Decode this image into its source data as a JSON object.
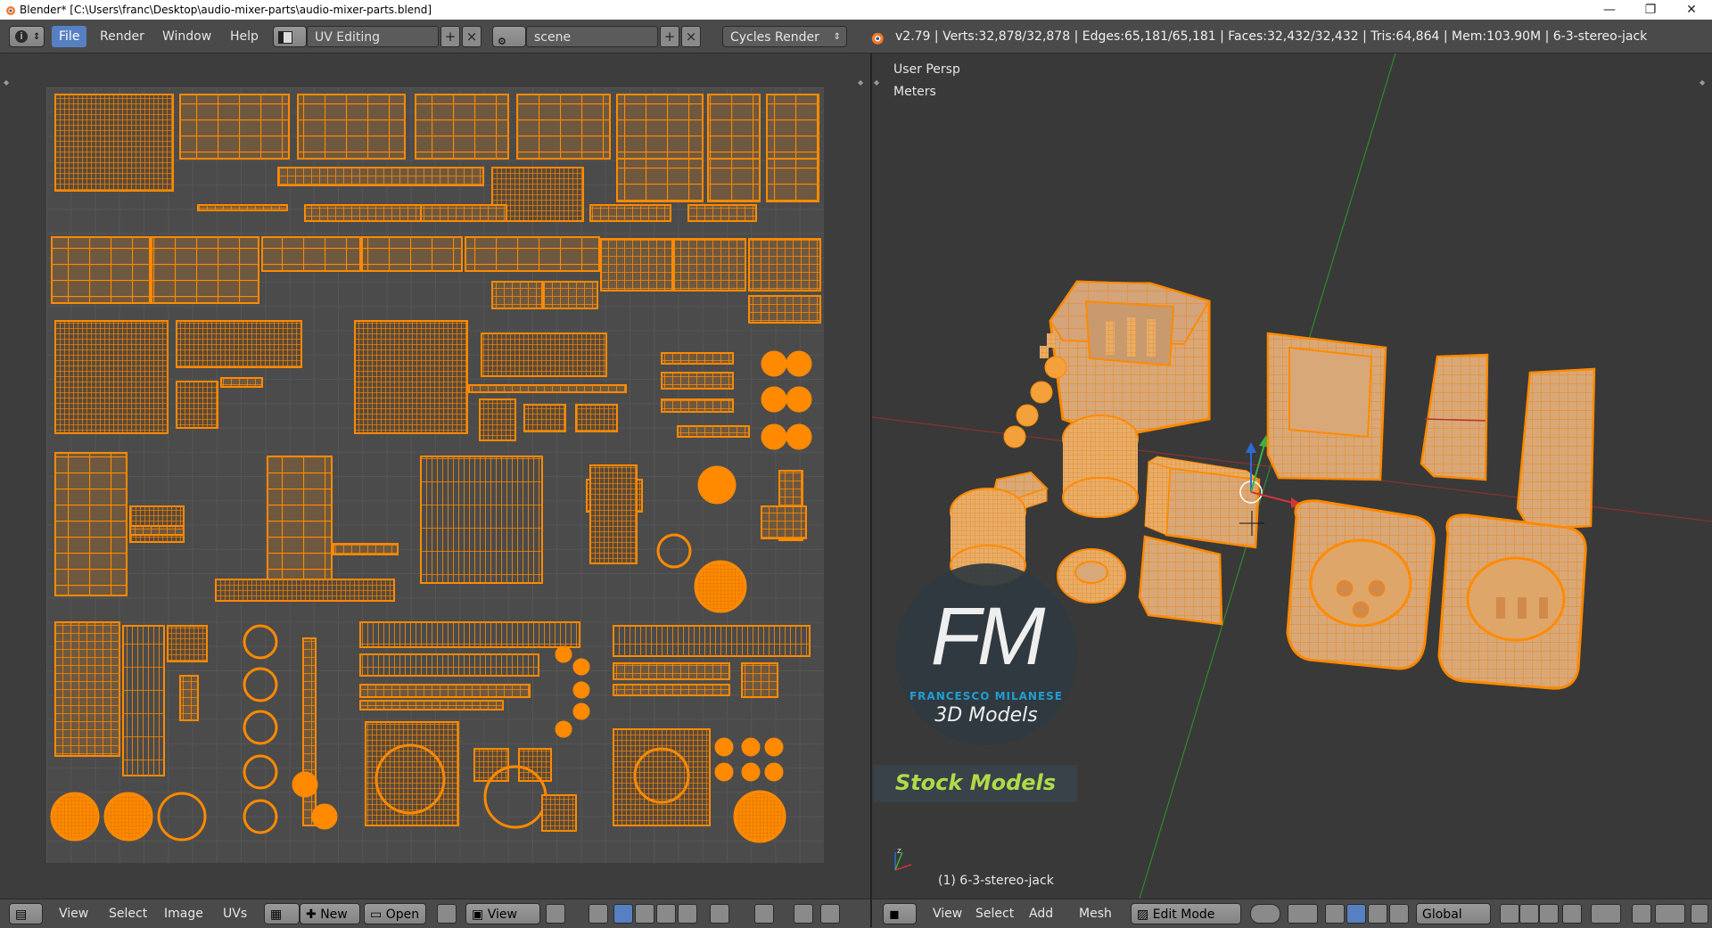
{
  "window": {
    "title": "Blender* [C:\\Users\\franc\\Desktop\\audio-mixer-parts\\audio-mixer-parts.blend]",
    "minimize": "—",
    "restore": "❐",
    "close": "✕"
  },
  "info_header": {
    "menus": [
      "File",
      "Render",
      "Window",
      "Help"
    ],
    "active_menu": "File",
    "layout": "UV Editing",
    "scene": "scene",
    "engine": "Cycles Render",
    "stats": "v2.79 | Verts:32,878/32,878 | Edges:65,181/65,181 | Faces:32,432/32,432 | Tris:64,864 | Mem:103.90M | 6-3-stereo-jack"
  },
  "viewport": {
    "view_name": "User Persp",
    "units": "Meters",
    "object_label": "(1) 6-3-stereo-jack"
  },
  "watermark": {
    "logo": "FM",
    "company": "FRANCESCO MILANESE",
    "tagline": "3D Models",
    "banner": "Stock Models"
  },
  "uv_footer": {
    "menus": [
      "View",
      "Select",
      "Image",
      "UVs"
    ],
    "new_label": "New",
    "open_label": "Open",
    "view_label": "View"
  },
  "vp_footer": {
    "menus": [
      "View",
      "Select",
      "Add",
      "Mesh"
    ],
    "mode": "Edit Mode",
    "orientation": "Global"
  },
  "colors": {
    "accent": "#5680c2",
    "wire": "#ff8a00",
    "face": "#6e5840"
  }
}
